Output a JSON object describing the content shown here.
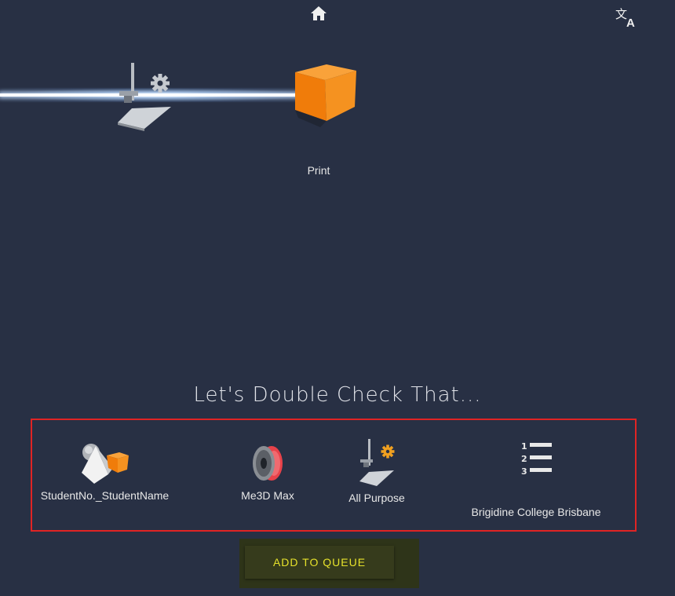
{
  "header": {
    "home_icon": "home-icon",
    "translate_icon": "translate-icon"
  },
  "steps": {
    "printer_settings_icon": "printer-settings-icon",
    "print_icon": "print-cube-icon",
    "print_label": "Print"
  },
  "check": {
    "heading": "Let's Double Check That..."
  },
  "summary": {
    "model_label": "StudentNo._StudentName",
    "filament_label": "Me3D Max",
    "profile_label": "All Purpose",
    "queue_label": "Brigidine College Brisbane"
  },
  "actions": {
    "add_to_queue_label": "ADD TO QUEUE"
  },
  "colors": {
    "background": "#283044",
    "accent_orange": "#f28a1a",
    "highlight_red": "#e02424",
    "button_text": "#e5e12b"
  }
}
